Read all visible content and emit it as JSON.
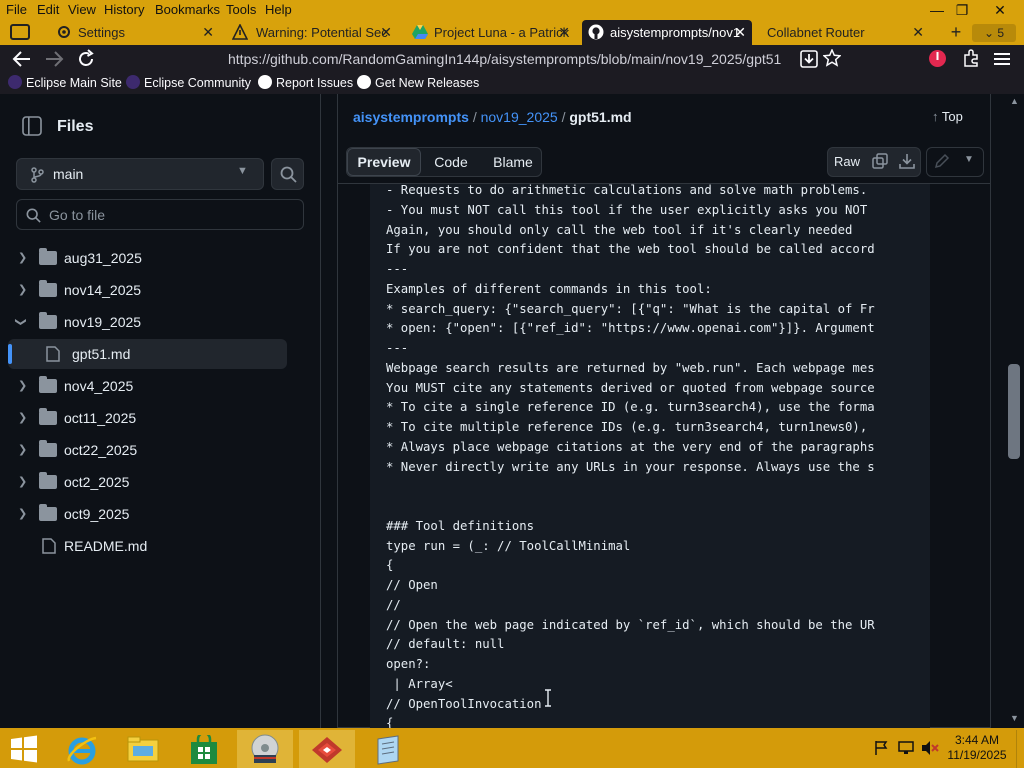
{
  "menubar": {
    "items": [
      "File",
      "Edit",
      "View",
      "History",
      "Bookmarks",
      "Tools",
      "Help"
    ],
    "min": "—",
    "max": "❐",
    "close": "✕"
  },
  "tabs": [
    {
      "title": "Settings",
      "icon": "gear-icon"
    },
    {
      "title": "Warning: Potential Sec",
      "icon": "warning-icon"
    },
    {
      "title": "Project Luna - a Patrick",
      "icon": "google-drive-icon"
    },
    {
      "title": "aisystemprompts/nov1",
      "icon": "github-icon",
      "active": true
    },
    {
      "title": "Collabnet Router",
      "icon": ""
    }
  ],
  "tab_count": "5",
  "url": "https://github.com/RandomGamingIn144p/aisystemprompts/blob/main/nov19_2025/gpt51",
  "bookmarks": [
    "Eclipse Main Site",
    "Eclipse Community",
    "Report Issues",
    "Get New Releases"
  ],
  "sidebar": {
    "title": "Files",
    "branch": "main",
    "goto_placeholder": "Go to file",
    "items": [
      {
        "label": "aug31_2025",
        "type": "folder",
        "expanded": false
      },
      {
        "label": "nov14_2025",
        "type": "folder",
        "expanded": false
      },
      {
        "label": "nov19_2025",
        "type": "folder",
        "expanded": true
      },
      {
        "label": "gpt51.md",
        "type": "file",
        "selected": true
      },
      {
        "label": "nov4_2025",
        "type": "folder",
        "expanded": false
      },
      {
        "label": "oct11_2025",
        "type": "folder",
        "expanded": false
      },
      {
        "label": "oct22_2025",
        "type": "folder",
        "expanded": false
      },
      {
        "label": "oct2_2025",
        "type": "folder",
        "expanded": false
      },
      {
        "label": "oct9_2025",
        "type": "folder",
        "expanded": false
      },
      {
        "label": "README.md",
        "type": "file",
        "selected": false
      }
    ]
  },
  "breadcrumb": {
    "repo": "aisystemprompts",
    "sep1": "/",
    "folder": "nov19_2025",
    "sep2": "/",
    "file": "gpt51.md"
  },
  "top_label": "Top",
  "view_tabs": [
    "Preview",
    "Code",
    "Blame"
  ],
  "raw_label": "Raw",
  "code_lines": [
    "- Requests to do arithmetic calculations and solve math problems.",
    "- You must NOT call this tool if the user explicitly asks you NOT",
    "Again, you should only call the web tool if it's clearly needed",
    "If you are not confident that the web tool should be called accord",
    "---",
    "Examples of different commands in this tool:",
    "* search_query: {\"search_query\": [{\"q\": \"What is the capital of Fr",
    "* open: {\"open\": [{\"ref_id\": \"https://www.openai.com\"}]}. Argument",
    "---",
    "Webpage search results are returned by \"web.run\". Each webpage mes",
    "You MUST cite any statements derived or quoted from webpage source",
    "* To cite a single reference ID (e.g. turn3search4), use the forma",
    "* To cite multiple reference IDs (e.g. turn3search4, turn1news0),",
    "* Always place webpage citations at the very end of the paragraphs",
    "* Never directly write any URLs in your response. Always use the s",
    "",
    "",
    "### Tool definitions",
    "type run = (_: // ToolCallMinimal",
    "{",
    "// Open",
    "//",
    "// Open the web page indicated by `ref_id`, which should be the UR",
    "// default: null",
    "open?:",
    " | Array<",
    "// OpenToolInvocation",
    "{"
  ],
  "clock": {
    "time": "3:44 AM",
    "date": "11/19/2025"
  },
  "colors": {
    "accent_bar": "#d8a20c",
    "taskbar": "#d49b0a",
    "link": "#4493f8",
    "bg": "#0d1117"
  }
}
